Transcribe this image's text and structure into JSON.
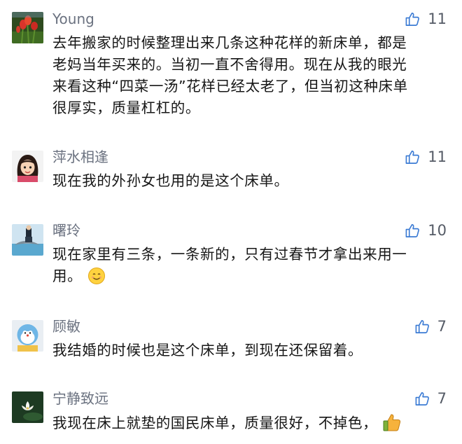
{
  "comments": [
    {
      "username": "Young",
      "avatar": "red-flower-avatar",
      "likes": "11",
      "lines": [
        "去年搬家的时候整理出来几条这种花样的新床单，都是",
        "老妈当年买来的。当初一直不舍得用。现在从我的眼光",
        "来看这种“四菜一汤”花样已经太老了，但当初这种床单",
        "很厚实，质量杠杠的。"
      ]
    },
    {
      "username": "萍水相逢",
      "avatar": "cartoon-girl-avatar",
      "likes": "11",
      "lines": [
        "现在我的外孙女也用的是这个床单。"
      ]
    },
    {
      "username": "曙玲",
      "avatar": "dolphin-photo-avatar",
      "likes": "10",
      "lines": [
        "现在家里有三条，一条新的，只有过春节才拿出来用一",
        "用。"
      ],
      "emoji": "smile-emoji"
    },
    {
      "username": "顾敏",
      "avatar": "blue-cartoon-avatar",
      "likes": "7",
      "lines": [
        "我结婚的时候也是这个床单，到现在还保留着。"
      ]
    },
    {
      "username": "宁静致远",
      "avatar": "white-lotus-avatar",
      "likes": "7",
      "lines": [
        "我现在床上就垫的国民床单，质量很好，不掉色，"
      ],
      "emoji": "thumbs-up-emoji"
    }
  ],
  "colors": {
    "username": "#6b7280",
    "text": "#161616",
    "like_icon": "#3b7bd4",
    "like_count": "#555b66"
  },
  "icons": {
    "like": "thumbs-up-outline-icon"
  }
}
